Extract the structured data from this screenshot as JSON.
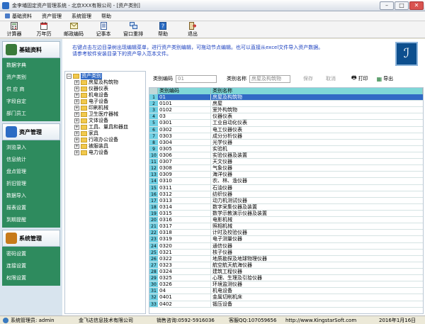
{
  "window": {
    "title": "金李埔固定资产管理系统 - 北京XXX有限公司 - [资产类别]"
  },
  "menu": [
    "基础资料",
    "资产管理",
    "系统管理",
    "帮助"
  ],
  "toolbar": [
    {
      "label": "计算器",
      "icon": "calculator-icon"
    },
    {
      "label": "万年历",
      "icon": "calendar-icon"
    },
    {
      "label": "邮政编码",
      "icon": "mail-icon"
    },
    {
      "label": "记事本",
      "icon": "notepad-icon"
    },
    {
      "label": "窗口重排",
      "icon": "windows-icon"
    },
    {
      "label": "帮助",
      "icon": "help-icon"
    },
    {
      "label": "退出",
      "icon": "exit-icon"
    }
  ],
  "sidebar": {
    "groups": [
      {
        "title": "基础资料",
        "items": [
          "数据字典",
          "资产类别",
          "供 应 商",
          "字段自定",
          "部门员工"
        ]
      },
      {
        "title": "资产管理",
        "items": [
          "浏览录入",
          "信息统计",
          "盘点管理",
          "折旧管理",
          "数据导入",
          "报表设置",
          "到期提醒"
        ]
      },
      {
        "title": "系统管理",
        "items": [
          "密码设置",
          "连接设置",
          "权限设置"
        ]
      }
    ]
  },
  "notice": {
    "line1": "右键点击左边目录树出现编辑菜单，进行资产类别编辑，可拖动节点编辑。也可以直接从excel文件导入资产数据。",
    "line2": "请参考软件安装目录下的资产导入范本文件。"
  },
  "tree": {
    "root": "资产类别",
    "children": [
      "房屋及构筑物",
      "仪器仪表",
      "机电设备",
      "电子设备",
      "印刷机械",
      "卫生医疗器械",
      "文体设备",
      "工具、量具和器皿",
      "家具",
      "行政办公设备",
      "被服装具",
      "电力设备"
    ]
  },
  "form": {
    "code_label": "类别编码",
    "code_value": "01",
    "name_label": "类别名称",
    "name_value": "房屋及构筑物",
    "save": "保存",
    "cancel": "取消",
    "print": "打印",
    "export": "导出"
  },
  "grid": {
    "headers": [
      "类别编码",
      "类别名称"
    ],
    "rows": [
      [
        "01",
        "房屋及构筑物"
      ],
      [
        "0101",
        "房屋"
      ],
      [
        "0102",
        "室外构筑物"
      ],
      [
        "03",
        "仪器仪表"
      ],
      [
        "0301",
        "工业自动化仪表"
      ],
      [
        "0302",
        "电工仪器仪表"
      ],
      [
        "0303",
        "成分分析仪器"
      ],
      [
        "0304",
        "光学仪器"
      ],
      [
        "0305",
        "实验机"
      ],
      [
        "0306",
        "实验仪器及装置"
      ],
      [
        "0307",
        "天文仪器"
      ],
      [
        "0308",
        "气象仪器"
      ],
      [
        "0309",
        "海洋仪器"
      ],
      [
        "0310",
        "农、林、渔仪器"
      ],
      [
        "0311",
        "石油仪器"
      ],
      [
        "0312",
        "纺织仪器"
      ],
      [
        "0313",
        "动力机测试仪器"
      ],
      [
        "0314",
        "数字采集仪器及装置"
      ],
      [
        "0315",
        "数学示教演示仪器及装置"
      ],
      [
        "0316",
        "电影机械"
      ],
      [
        "0317",
        "照相机械"
      ],
      [
        "0318",
        "计时及校验仪器"
      ],
      [
        "0319",
        "电子测量仪器"
      ],
      [
        "0320",
        "通信仪器"
      ],
      [
        "0321",
        "核子仪器"
      ],
      [
        "0322",
        "地质勘探及地球物理仪器"
      ],
      [
        "0323",
        "航空航天航海仪器"
      ],
      [
        "0324",
        "建筑工程仪器"
      ],
      [
        "0325",
        "心理、生理及引拾仪器"
      ],
      [
        "0326",
        "环境监测仪器"
      ],
      [
        "04",
        "机电设备"
      ],
      [
        "0401",
        "金属切削机床"
      ],
      [
        "0402",
        "锻压设备"
      ]
    ]
  },
  "status": {
    "user": "系统管理员: admin",
    "company": "金飞达信息技术有限公司",
    "phone": "销售咨询:0592-5916036",
    "qq": "客服QQ:107059656",
    "url": "http://www.KingstarSoft.com",
    "date": "2016年1月16日"
  },
  "colors": {
    "sidebar_green": "#2e8b5e",
    "grid_header": "#7fd7d7",
    "notice_blue": "#1a3fbf"
  }
}
